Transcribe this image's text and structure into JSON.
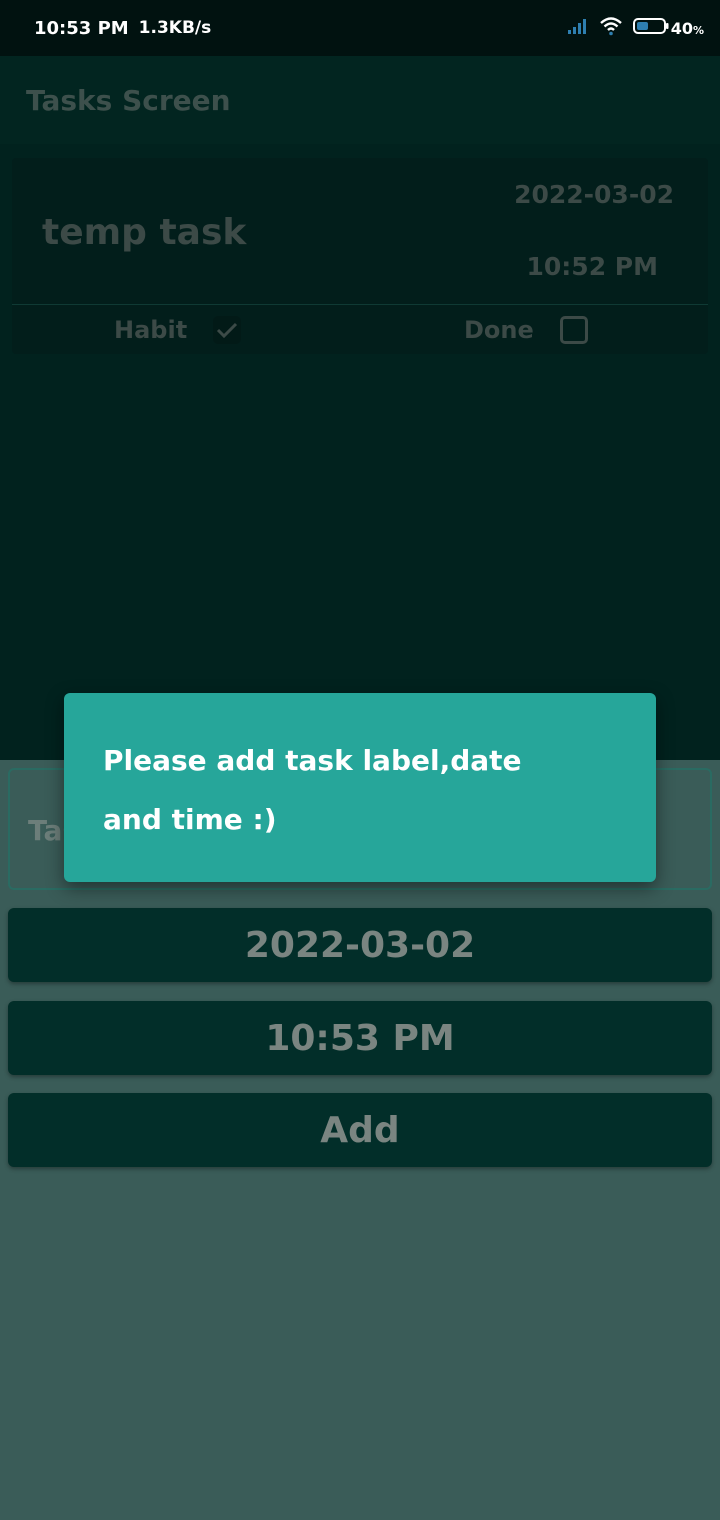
{
  "status_bar": {
    "time": "10:53 PM",
    "speed": "1.3KB/s",
    "battery": "40",
    "battery_unit": "%"
  },
  "app_bar": {
    "title": "Tasks Screen"
  },
  "task": {
    "title": "temp task",
    "date": "2022-03-02",
    "time": "10:52 PM",
    "habit_label": "Habit",
    "habit_checked": true,
    "done_label": "Done",
    "done_checked": false
  },
  "form": {
    "task_input_visible_text": "Tas",
    "date_button": "2022-03-02",
    "time_button": "10:53 PM",
    "add_button": "Add"
  },
  "toast": {
    "message": "Please add task label,date and time :)"
  },
  "colors": {
    "toast_bg": "#26a69a",
    "button_bg": "#022e29",
    "screen_bg": "#3a5c58"
  }
}
